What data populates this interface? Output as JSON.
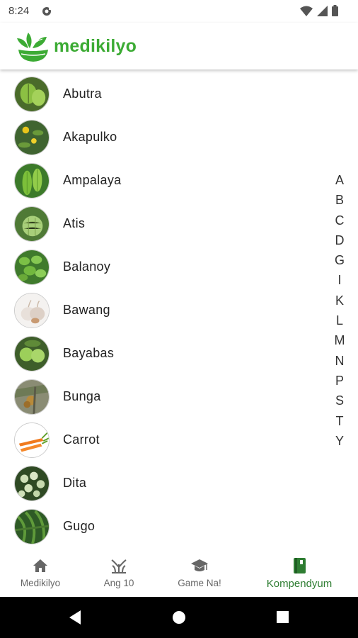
{
  "status_bar": {
    "time": "8:24"
  },
  "app": {
    "title": "medikilyo",
    "brand_color": "#3cab34"
  },
  "list": {
    "items": [
      {
        "label": "Abutra",
        "thumb": "leaf"
      },
      {
        "label": "Akapulko",
        "thumb": "yellow-flower"
      },
      {
        "label": "Ampalaya",
        "thumb": "bitter-gourd"
      },
      {
        "label": "Atis",
        "thumb": "sugar-apple"
      },
      {
        "label": "Balanoy",
        "thumb": "basil"
      },
      {
        "label": "Bawang",
        "thumb": "garlic"
      },
      {
        "label": "Bayabas",
        "thumb": "guava"
      },
      {
        "label": "Bunga",
        "thumb": "areca-nut"
      },
      {
        "label": "Carrot",
        "thumb": "carrot"
      },
      {
        "label": "Dita",
        "thumb": "dita-tree"
      },
      {
        "label": "Gugo",
        "thumb": "vine"
      }
    ]
  },
  "alphabet_index": [
    "A",
    "B",
    "C",
    "D",
    "G",
    "I",
    "K",
    "L",
    "M",
    "N",
    "P",
    "S",
    "T",
    "Y"
  ],
  "bottom_nav": {
    "items": [
      {
        "label": "Medikilyo",
        "icon": "home-icon"
      },
      {
        "label": "Ang 10",
        "icon": "sprout-icon"
      },
      {
        "label": "Game Na!",
        "icon": "graduation-cap-icon"
      },
      {
        "label": "Kompendyum",
        "icon": "book-icon",
        "active": true
      }
    ],
    "active_color": "#2e7d32"
  }
}
